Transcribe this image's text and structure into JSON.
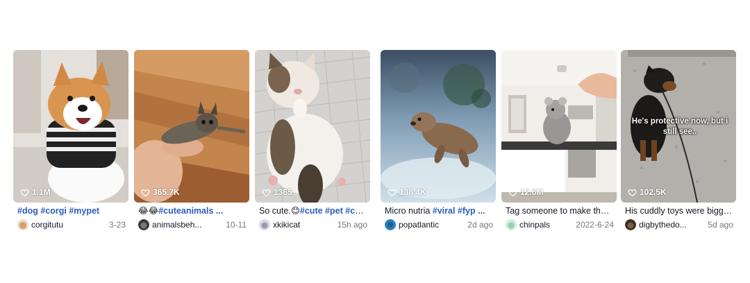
{
  "cards": [
    {
      "views": "1.1M",
      "caption_text": "",
      "caption_tags": "#dog #corgi #mypet",
      "author": "corgitutu",
      "date": "3-23",
      "overlay": "",
      "avatar_color": "#d4a16a",
      "thumb_colors": [
        "#e8e4df",
        "#b7ada3",
        "#6f5c4b"
      ]
    },
    {
      "views": "365.7K",
      "caption_text": "😂😂",
      "caption_tags": "#cuteanimals ...",
      "author": "animalsbeh...",
      "date": "10-11",
      "overlay": "",
      "avatar_color": "#3a3a3a",
      "thumb_colors": [
        "#c98a52",
        "#a86a37",
        "#7a4a24"
      ]
    },
    {
      "views": "1365",
      "caption_text": "So cute.😊",
      "caption_tags": "#cute #pet #cat ...",
      "author": "xkikicat",
      "date": "15h ago",
      "overlay": "",
      "avatar_color": "#c9c9d6",
      "thumb_colors": [
        "#d9d8d4",
        "#b7b5b0",
        "#8a8884"
      ]
    },
    {
      "views": "138.4K",
      "caption_text": "Micro nutria ",
      "caption_tags": "#viral #fyp ...",
      "author": "popatlantic",
      "date": "2d ago",
      "overlay": "",
      "avatar_color": "#2a7fbf",
      "thumb_colors": [
        "#40556e",
        "#a9c3d3",
        "#d8e6ee"
      ]
    },
    {
      "views": "12.6M",
      "caption_text": "Tag someone to make their ...",
      "caption_tags": "",
      "author": "chinpals",
      "date": "2022-6-24",
      "overlay": "",
      "avatar_color": "#8fd3b0",
      "thumb_colors": [
        "#f2efeb",
        "#c7c2bc",
        "#5e5a56"
      ]
    },
    {
      "views": "102.5K",
      "caption_text": "His cuddly toys were bigger ...",
      "caption_tags": "",
      "author": "digbythedo...",
      "date": "5d ago",
      "overlay": "He's protective now, but i still see..",
      "avatar_color": "#5a4632",
      "thumb_colors": [
        "#b9b6b1",
        "#9e9a95",
        "#7d7974"
      ]
    }
  ]
}
